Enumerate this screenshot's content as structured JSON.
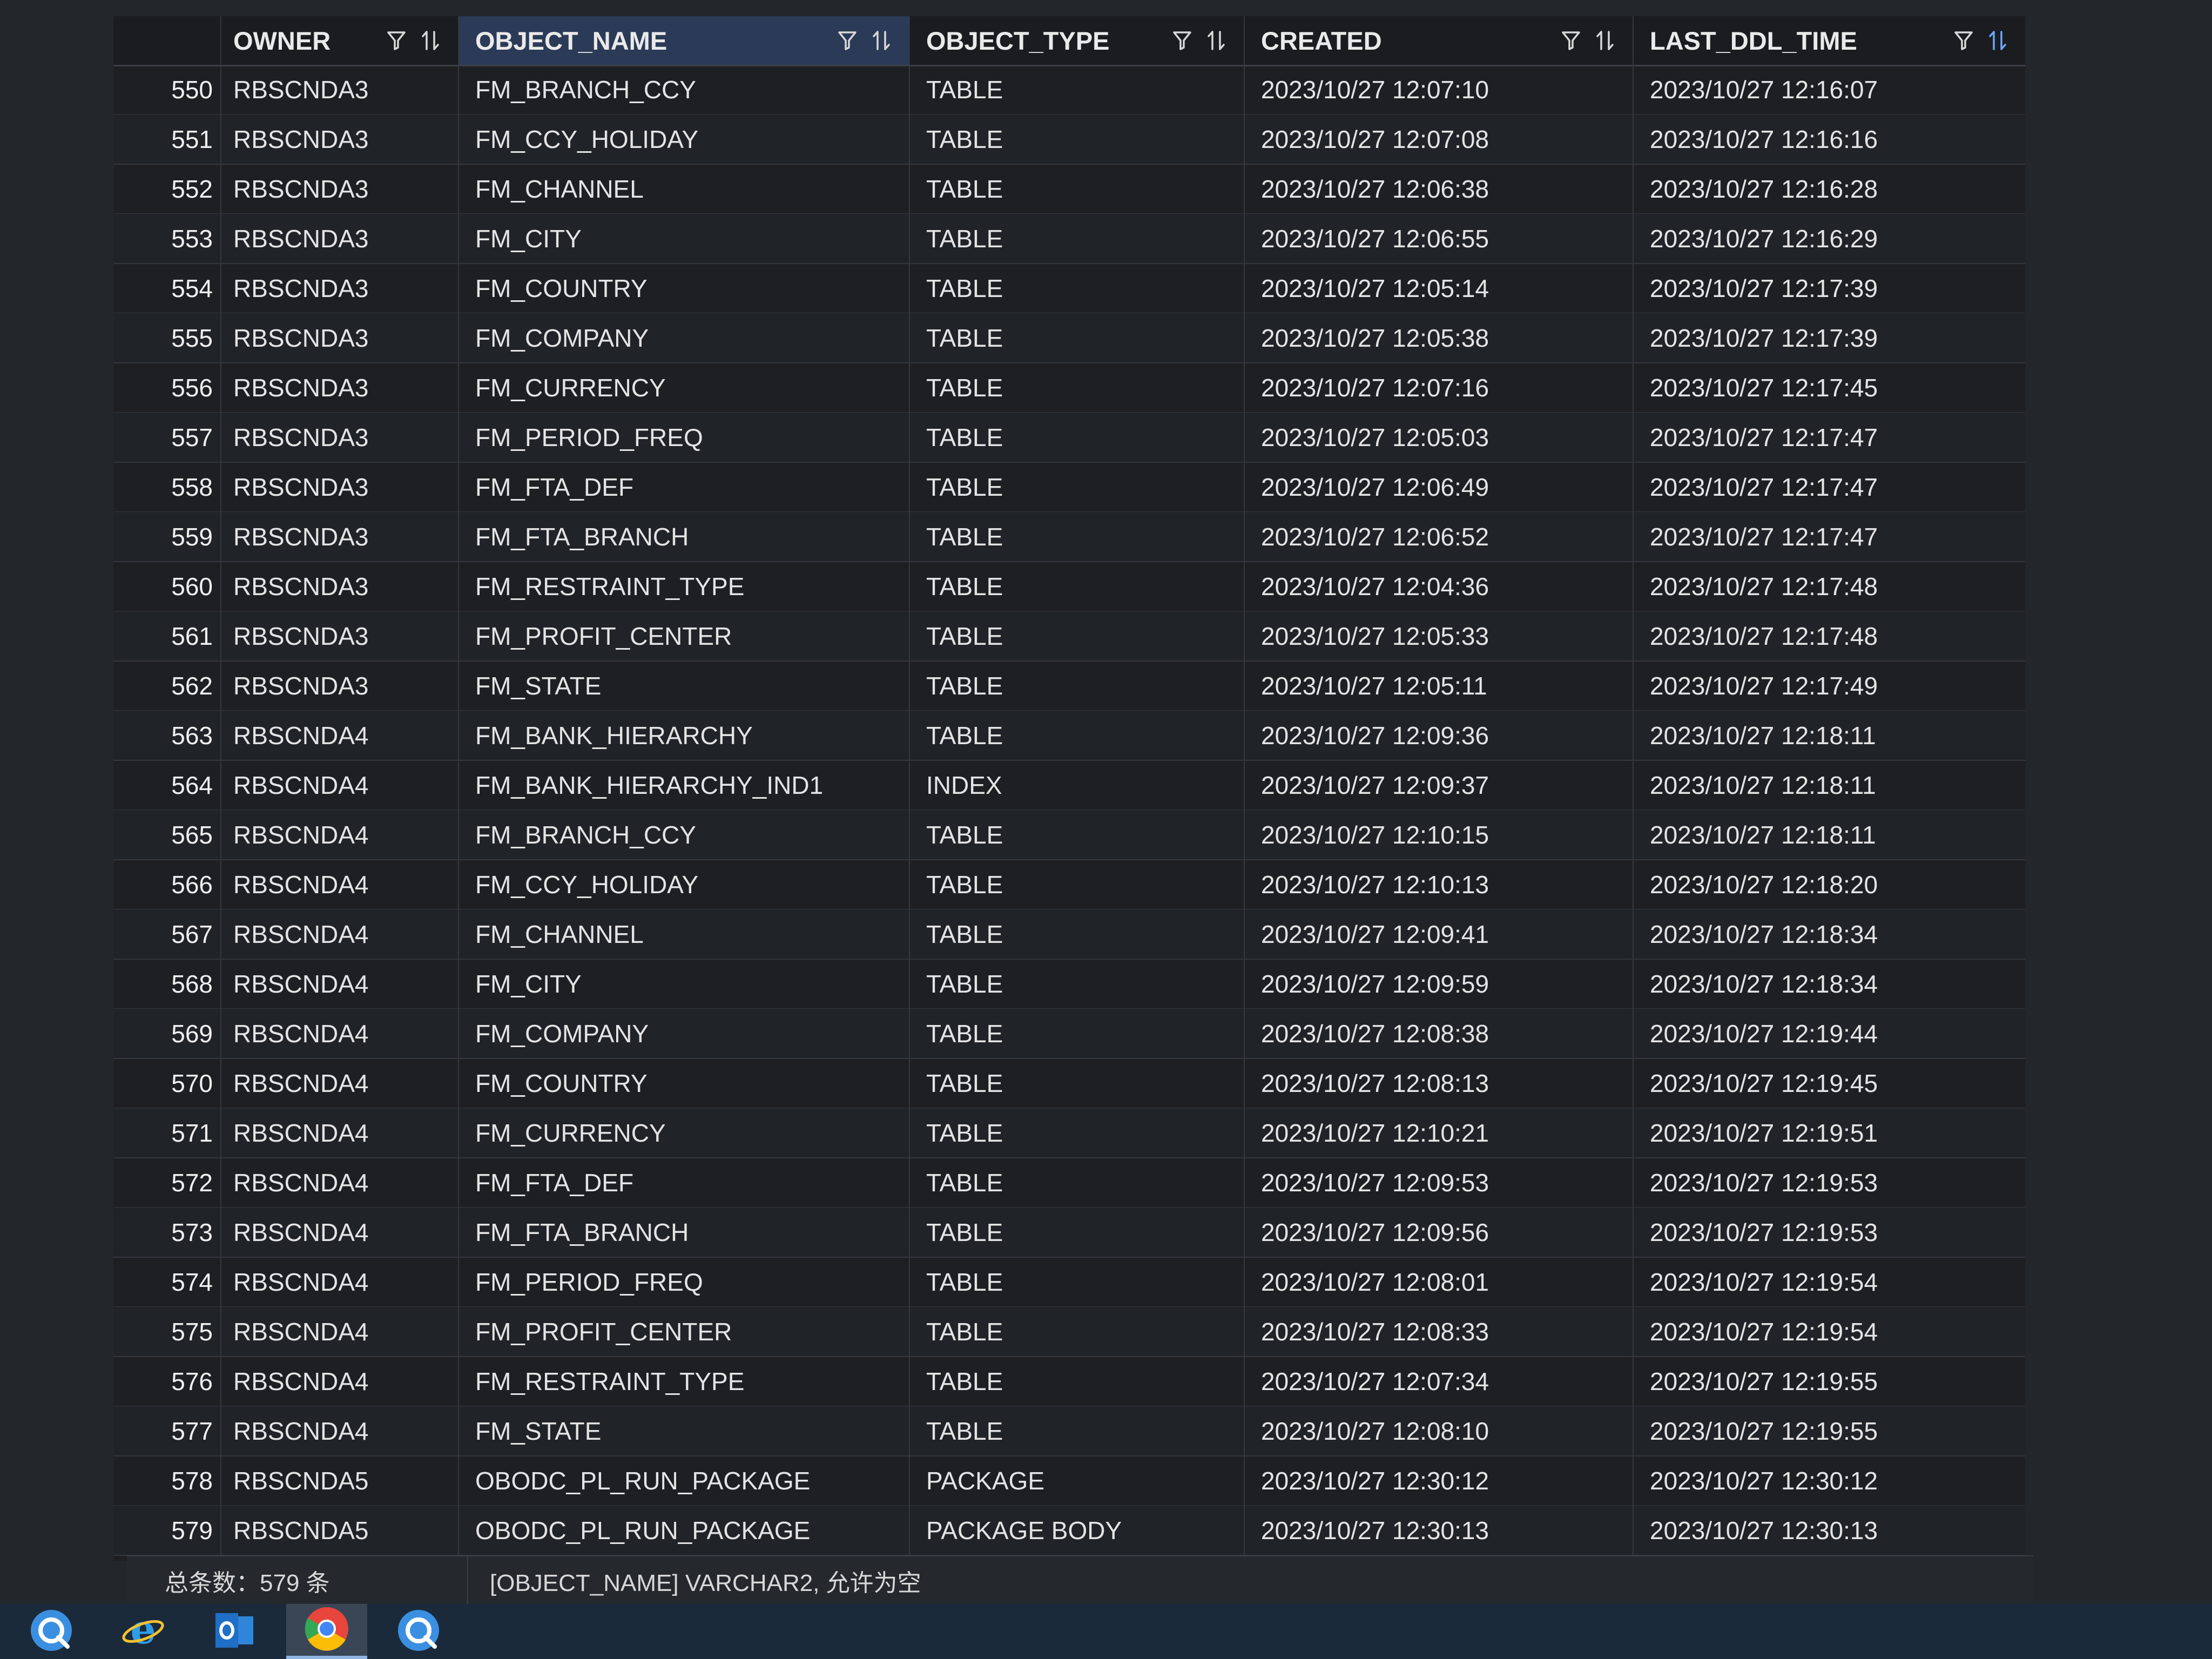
{
  "columns": [
    {
      "label": "OWNER"
    },
    {
      "label": "OBJECT_NAME"
    },
    {
      "label": "OBJECT_TYPE"
    },
    {
      "label": "CREATED"
    },
    {
      "label": "LAST_DDL_TIME"
    }
  ],
  "rows": [
    {
      "num": "550",
      "owner": "RBSCNDA3",
      "name": "FM_BRANCH_CCY",
      "type": "TABLE",
      "created": "2023/10/27 12:07:10",
      "ddl": "2023/10/27 12:16:07"
    },
    {
      "num": "551",
      "owner": "RBSCNDA3",
      "name": "FM_CCY_HOLIDAY",
      "type": "TABLE",
      "created": "2023/10/27 12:07:08",
      "ddl": "2023/10/27 12:16:16"
    },
    {
      "num": "552",
      "owner": "RBSCNDA3",
      "name": "FM_CHANNEL",
      "type": "TABLE",
      "created": "2023/10/27 12:06:38",
      "ddl": "2023/10/27 12:16:28"
    },
    {
      "num": "553",
      "owner": "RBSCNDA3",
      "name": "FM_CITY",
      "type": "TABLE",
      "created": "2023/10/27 12:06:55",
      "ddl": "2023/10/27 12:16:29"
    },
    {
      "num": "554",
      "owner": "RBSCNDA3",
      "name": "FM_COUNTRY",
      "type": "TABLE",
      "created": "2023/10/27 12:05:14",
      "ddl": "2023/10/27 12:17:39"
    },
    {
      "num": "555",
      "owner": "RBSCNDA3",
      "name": "FM_COMPANY",
      "type": "TABLE",
      "created": "2023/10/27 12:05:38",
      "ddl": "2023/10/27 12:17:39"
    },
    {
      "num": "556",
      "owner": "RBSCNDA3",
      "name": "FM_CURRENCY",
      "type": "TABLE",
      "created": "2023/10/27 12:07:16",
      "ddl": "2023/10/27 12:17:45"
    },
    {
      "num": "557",
      "owner": "RBSCNDA3",
      "name": "FM_PERIOD_FREQ",
      "type": "TABLE",
      "created": "2023/10/27 12:05:03",
      "ddl": "2023/10/27 12:17:47"
    },
    {
      "num": "558",
      "owner": "RBSCNDA3",
      "name": "FM_FTA_DEF",
      "type": "TABLE",
      "created": "2023/10/27 12:06:49",
      "ddl": "2023/10/27 12:17:47"
    },
    {
      "num": "559",
      "owner": "RBSCNDA3",
      "name": "FM_FTA_BRANCH",
      "type": "TABLE",
      "created": "2023/10/27 12:06:52",
      "ddl": "2023/10/27 12:17:47"
    },
    {
      "num": "560",
      "owner": "RBSCNDA3",
      "name": "FM_RESTRAINT_TYPE",
      "type": "TABLE",
      "created": "2023/10/27 12:04:36",
      "ddl": "2023/10/27 12:17:48"
    },
    {
      "num": "561",
      "owner": "RBSCNDA3",
      "name": "FM_PROFIT_CENTER",
      "type": "TABLE",
      "created": "2023/10/27 12:05:33",
      "ddl": "2023/10/27 12:17:48"
    },
    {
      "num": "562",
      "owner": "RBSCNDA3",
      "name": "FM_STATE",
      "type": "TABLE",
      "created": "2023/10/27 12:05:11",
      "ddl": "2023/10/27 12:17:49"
    },
    {
      "num": "563",
      "owner": "RBSCNDA4",
      "name": "FM_BANK_HIERARCHY",
      "type": "TABLE",
      "created": "2023/10/27 12:09:36",
      "ddl": "2023/10/27 12:18:11"
    },
    {
      "num": "564",
      "owner": "RBSCNDA4",
      "name": "FM_BANK_HIERARCHY_IND1",
      "type": "INDEX",
      "created": "2023/10/27 12:09:37",
      "ddl": "2023/10/27 12:18:11"
    },
    {
      "num": "565",
      "owner": "RBSCNDA4",
      "name": "FM_BRANCH_CCY",
      "type": "TABLE",
      "created": "2023/10/27 12:10:15",
      "ddl": "2023/10/27 12:18:11"
    },
    {
      "num": "566",
      "owner": "RBSCNDA4",
      "name": "FM_CCY_HOLIDAY",
      "type": "TABLE",
      "created": "2023/10/27 12:10:13",
      "ddl": "2023/10/27 12:18:20"
    },
    {
      "num": "567",
      "owner": "RBSCNDA4",
      "name": "FM_CHANNEL",
      "type": "TABLE",
      "created": "2023/10/27 12:09:41",
      "ddl": "2023/10/27 12:18:34"
    },
    {
      "num": "568",
      "owner": "RBSCNDA4",
      "name": "FM_CITY",
      "type": "TABLE",
      "created": "2023/10/27 12:09:59",
      "ddl": "2023/10/27 12:18:34"
    },
    {
      "num": "569",
      "owner": "RBSCNDA4",
      "name": "FM_COMPANY",
      "type": "TABLE",
      "created": "2023/10/27 12:08:38",
      "ddl": "2023/10/27 12:19:44"
    },
    {
      "num": "570",
      "owner": "RBSCNDA4",
      "name": "FM_COUNTRY",
      "type": "TABLE",
      "created": "2023/10/27 12:08:13",
      "ddl": "2023/10/27 12:19:45"
    },
    {
      "num": "571",
      "owner": "RBSCNDA4",
      "name": "FM_CURRENCY",
      "type": "TABLE",
      "created": "2023/10/27 12:10:21",
      "ddl": "2023/10/27 12:19:51"
    },
    {
      "num": "572",
      "owner": "RBSCNDA4",
      "name": "FM_FTA_DEF",
      "type": "TABLE",
      "created": "2023/10/27 12:09:53",
      "ddl": "2023/10/27 12:19:53"
    },
    {
      "num": "573",
      "owner": "RBSCNDA4",
      "name": "FM_FTA_BRANCH",
      "type": "TABLE",
      "created": "2023/10/27 12:09:56",
      "ddl": "2023/10/27 12:19:53"
    },
    {
      "num": "574",
      "owner": "RBSCNDA4",
      "name": "FM_PERIOD_FREQ",
      "type": "TABLE",
      "created": "2023/10/27 12:08:01",
      "ddl": "2023/10/27 12:19:54"
    },
    {
      "num": "575",
      "owner": "RBSCNDA4",
      "name": "FM_PROFIT_CENTER",
      "type": "TABLE",
      "created": "2023/10/27 12:08:33",
      "ddl": "2023/10/27 12:19:54"
    },
    {
      "num": "576",
      "owner": "RBSCNDA4",
      "name": "FM_RESTRAINT_TYPE",
      "type": "TABLE",
      "created": "2023/10/27 12:07:34",
      "ddl": "2023/10/27 12:19:55"
    },
    {
      "num": "577",
      "owner": "RBSCNDA4",
      "name": "FM_STATE",
      "type": "TABLE",
      "created": "2023/10/27 12:08:10",
      "ddl": "2023/10/27 12:19:55"
    },
    {
      "num": "578",
      "owner": "RBSCNDA5",
      "name": "OBODC_PL_RUN_PACKAGE",
      "type": "PACKAGE",
      "created": "2023/10/27 12:30:12",
      "ddl": "2023/10/27 12:30:12"
    },
    {
      "num": "579",
      "owner": "RBSCNDA5",
      "name": "OBODC_PL_RUN_PACKAGE",
      "type": "PACKAGE BODY",
      "created": "2023/10/27 12:30:13",
      "ddl": "2023/10/27 12:30:13"
    }
  ],
  "status": {
    "total": "总条数：579 条",
    "column_info": "[OBJECT_NAME] VARCHAR2, 允许为空"
  },
  "taskbar": [
    {
      "icon": "app-blue-icon",
      "color": "#3b8fe0"
    },
    {
      "icon": "ie-icon",
      "color": "#2f9ee8"
    },
    {
      "icon": "outlook-icon",
      "color": "#1f6fc6"
    },
    {
      "icon": "chrome-icon",
      "color": "#e8453c",
      "active": true
    },
    {
      "icon": "app-blue-icon",
      "color": "#3b8fe0"
    }
  ],
  "colors": {
    "accent": "#6aa8ff",
    "selected_header": "#2b3b57"
  }
}
